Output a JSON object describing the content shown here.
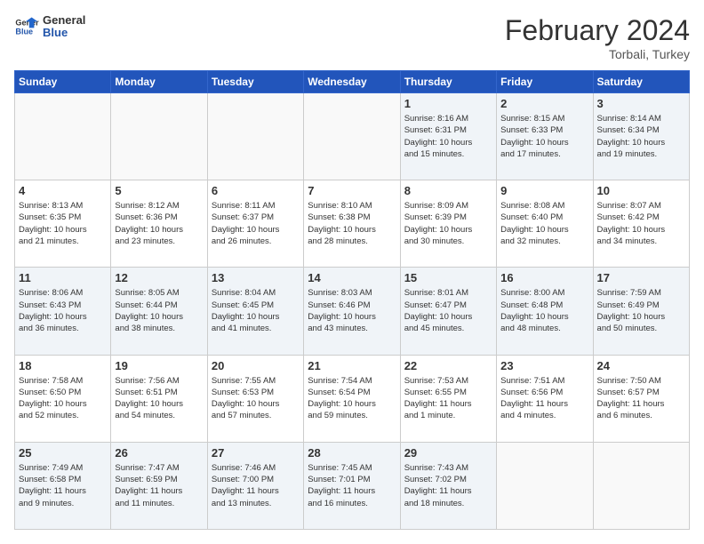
{
  "header": {
    "logo_general": "General",
    "logo_blue": "Blue",
    "month_title": "February 2024",
    "location": "Torbali, Turkey"
  },
  "days_of_week": [
    "Sunday",
    "Monday",
    "Tuesday",
    "Wednesday",
    "Thursday",
    "Friday",
    "Saturday"
  ],
  "weeks": [
    [
      {
        "day": "",
        "info": ""
      },
      {
        "day": "",
        "info": ""
      },
      {
        "day": "",
        "info": ""
      },
      {
        "day": "",
        "info": ""
      },
      {
        "day": "1",
        "info": "Sunrise: 8:16 AM\nSunset: 6:31 PM\nDaylight: 10 hours\nand 15 minutes."
      },
      {
        "day": "2",
        "info": "Sunrise: 8:15 AM\nSunset: 6:33 PM\nDaylight: 10 hours\nand 17 minutes."
      },
      {
        "day": "3",
        "info": "Sunrise: 8:14 AM\nSunset: 6:34 PM\nDaylight: 10 hours\nand 19 minutes."
      }
    ],
    [
      {
        "day": "4",
        "info": "Sunrise: 8:13 AM\nSunset: 6:35 PM\nDaylight: 10 hours\nand 21 minutes."
      },
      {
        "day": "5",
        "info": "Sunrise: 8:12 AM\nSunset: 6:36 PM\nDaylight: 10 hours\nand 23 minutes."
      },
      {
        "day": "6",
        "info": "Sunrise: 8:11 AM\nSunset: 6:37 PM\nDaylight: 10 hours\nand 26 minutes."
      },
      {
        "day": "7",
        "info": "Sunrise: 8:10 AM\nSunset: 6:38 PM\nDaylight: 10 hours\nand 28 minutes."
      },
      {
        "day": "8",
        "info": "Sunrise: 8:09 AM\nSunset: 6:39 PM\nDaylight: 10 hours\nand 30 minutes."
      },
      {
        "day": "9",
        "info": "Sunrise: 8:08 AM\nSunset: 6:40 PM\nDaylight: 10 hours\nand 32 minutes."
      },
      {
        "day": "10",
        "info": "Sunrise: 8:07 AM\nSunset: 6:42 PM\nDaylight: 10 hours\nand 34 minutes."
      }
    ],
    [
      {
        "day": "11",
        "info": "Sunrise: 8:06 AM\nSunset: 6:43 PM\nDaylight: 10 hours\nand 36 minutes."
      },
      {
        "day": "12",
        "info": "Sunrise: 8:05 AM\nSunset: 6:44 PM\nDaylight: 10 hours\nand 38 minutes."
      },
      {
        "day": "13",
        "info": "Sunrise: 8:04 AM\nSunset: 6:45 PM\nDaylight: 10 hours\nand 41 minutes."
      },
      {
        "day": "14",
        "info": "Sunrise: 8:03 AM\nSunset: 6:46 PM\nDaylight: 10 hours\nand 43 minutes."
      },
      {
        "day": "15",
        "info": "Sunrise: 8:01 AM\nSunset: 6:47 PM\nDaylight: 10 hours\nand 45 minutes."
      },
      {
        "day": "16",
        "info": "Sunrise: 8:00 AM\nSunset: 6:48 PM\nDaylight: 10 hours\nand 48 minutes."
      },
      {
        "day": "17",
        "info": "Sunrise: 7:59 AM\nSunset: 6:49 PM\nDaylight: 10 hours\nand 50 minutes."
      }
    ],
    [
      {
        "day": "18",
        "info": "Sunrise: 7:58 AM\nSunset: 6:50 PM\nDaylight: 10 hours\nand 52 minutes."
      },
      {
        "day": "19",
        "info": "Sunrise: 7:56 AM\nSunset: 6:51 PM\nDaylight: 10 hours\nand 54 minutes."
      },
      {
        "day": "20",
        "info": "Sunrise: 7:55 AM\nSunset: 6:53 PM\nDaylight: 10 hours\nand 57 minutes."
      },
      {
        "day": "21",
        "info": "Sunrise: 7:54 AM\nSunset: 6:54 PM\nDaylight: 10 hours\nand 59 minutes."
      },
      {
        "day": "22",
        "info": "Sunrise: 7:53 AM\nSunset: 6:55 PM\nDaylight: 11 hours\nand 1 minute."
      },
      {
        "day": "23",
        "info": "Sunrise: 7:51 AM\nSunset: 6:56 PM\nDaylight: 11 hours\nand 4 minutes."
      },
      {
        "day": "24",
        "info": "Sunrise: 7:50 AM\nSunset: 6:57 PM\nDaylight: 11 hours\nand 6 minutes."
      }
    ],
    [
      {
        "day": "25",
        "info": "Sunrise: 7:49 AM\nSunset: 6:58 PM\nDaylight: 11 hours\nand 9 minutes."
      },
      {
        "day": "26",
        "info": "Sunrise: 7:47 AM\nSunset: 6:59 PM\nDaylight: 11 hours\nand 11 minutes."
      },
      {
        "day": "27",
        "info": "Sunrise: 7:46 AM\nSunset: 7:00 PM\nDaylight: 11 hours\nand 13 minutes."
      },
      {
        "day": "28",
        "info": "Sunrise: 7:45 AM\nSunset: 7:01 PM\nDaylight: 11 hours\nand 16 minutes."
      },
      {
        "day": "29",
        "info": "Sunrise: 7:43 AM\nSunset: 7:02 PM\nDaylight: 11 hours\nand 18 minutes."
      },
      {
        "day": "",
        "info": ""
      },
      {
        "day": "",
        "info": ""
      }
    ]
  ]
}
